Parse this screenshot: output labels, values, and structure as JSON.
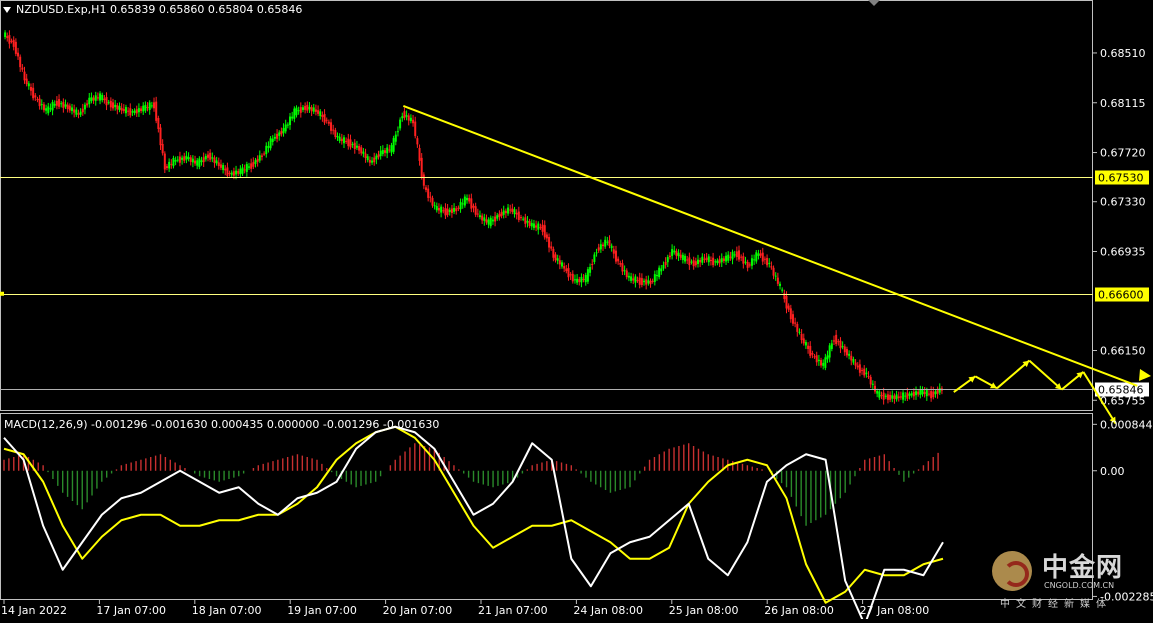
{
  "header": {
    "main_label": "NZDUSD.Exp,H1  0.65839 0.65860 0.65804 0.65846",
    "macd_label": "MACD(12,26,9) -0.001296 -0.001630 0.000435 0.000000 -0.001296 -0.001630"
  },
  "watermark": {
    "name": "中金网",
    "url": "CNGOLD.COM.CN",
    "subtitle": "中文财经新媒体"
  },
  "colors": {
    "background": "#000000",
    "bull": "#00ff00",
    "bear": "#ff2020",
    "trend": "#ffff00",
    "level_line": "#ffff80",
    "price_line": "#b0b0b0",
    "macd_line": "#ffffff",
    "signal_line": "#ffff00",
    "hist_pos": "#c83030",
    "hist_neg": "#2a8a2a",
    "axis_text": "#ffffff",
    "border": "#c0c0c0"
  },
  "chart_data": [
    {
      "type": "candlestick",
      "symbol": "NZDUSD.Exp",
      "timeframe": "H1",
      "ohlc_current": {
        "open": 0.65839,
        "high": 0.6586,
        "low": 0.65804,
        "close": 0.65846
      },
      "ylim": [
        0.6567,
        0.6893
      ],
      "y_ticks": [
        0.6851,
        0.68115,
        0.6772,
        0.6733,
        0.66935,
        0.6615,
        0.65755
      ],
      "x_ticks": [
        "14 Jan 2022",
        "17 Jan 07:00",
        "18 Jan 07:00",
        "19 Jan 07:00",
        "20 Jan 07:00",
        "21 Jan 07:00",
        "24 Jan 08:00",
        "25 Jan 08:00",
        "26 Jan 08:00",
        "27 Jan 08:00"
      ],
      "levels": [
        {
          "value": 0.6753,
          "label": "0.67530"
        },
        {
          "value": 0.666,
          "label": "0.66600"
        }
      ],
      "current_price": {
        "value": 0.65846,
        "label": "0.65846"
      },
      "path_closes": [
        0.6866,
        0.6858,
        0.683,
        0.6815,
        0.6805,
        0.6812,
        0.6808,
        0.6802,
        0.6814,
        0.6816,
        0.681,
        0.6806,
        0.6804,
        0.6807,
        0.681,
        0.676,
        0.6766,
        0.6768,
        0.6763,
        0.677,
        0.6762,
        0.6755,
        0.6757,
        0.6762,
        0.677,
        0.6783,
        0.679,
        0.6804,
        0.6808,
        0.6805,
        0.6797,
        0.6783,
        0.678,
        0.6775,
        0.6764,
        0.6772,
        0.6775,
        0.6803,
        0.6796,
        0.6745,
        0.6728,
        0.6725,
        0.6727,
        0.6736,
        0.6722,
        0.6716,
        0.6723,
        0.6727,
        0.672,
        0.6714,
        0.6712,
        0.669,
        0.668,
        0.667,
        0.6672,
        0.6695,
        0.6702,
        0.6685,
        0.6672,
        0.667,
        0.6669,
        0.668,
        0.6694,
        0.6688,
        0.6684,
        0.6688,
        0.6685,
        0.6688,
        0.6692,
        0.6682,
        0.6692,
        0.6683,
        0.6665,
        0.6642,
        0.6624,
        0.6611,
        0.6603,
        0.6625,
        0.6615,
        0.6603,
        0.6596,
        0.658,
        0.6578,
        0.6578,
        0.658,
        0.6582,
        0.658,
        0.65846
      ],
      "trendline": [
        {
          "time_index": 37,
          "value": 0.6809
        },
        {
          "time_index": 105,
          "value": 0.6587
        }
      ],
      "forecast_path": [
        {
          "time_index": 88,
          "value": 0.6582
        },
        {
          "time_index": 90,
          "value": 0.65945
        },
        {
          "time_index": 92,
          "value": 0.6585
        },
        {
          "time_index": 95,
          "value": 0.6607
        },
        {
          "time_index": 98,
          "value": 0.6584
        },
        {
          "time_index": 100,
          "value": 0.6598
        },
        {
          "time_index": 103,
          "value": 0.6557
        }
      ]
    },
    {
      "type": "line",
      "name": "MACD(12,26,9)",
      "ylim": [
        -0.00235,
        0.00105
      ],
      "y_ticks": [
        0.000844,
        0.0,
        -0.002285
      ],
      "macd_line": [
        0.0006,
        0.0002,
        -0.001,
        -0.0018,
        -0.0013,
        -0.0008,
        -0.0005,
        -0.0004,
        -0.0002,
        0.0,
        -0.0002,
        -0.0004,
        -0.0003,
        -0.0006,
        -0.0008,
        -0.0005,
        -0.0004,
        -0.0002,
        0.0004,
        0.0007,
        0.0008,
        0.0007,
        0.0004,
        -0.0002,
        -0.0008,
        -0.0006,
        -0.0002,
        0.0005,
        0.0002,
        -0.0016,
        -0.0021,
        -0.0015,
        -0.0013,
        -0.0012,
        -0.0009,
        -0.0006,
        -0.0016,
        -0.0019,
        -0.0013,
        -0.0002,
        0.0001,
        0.0003,
        0.0002,
        -0.002,
        -0.0028,
        -0.0018,
        -0.0018,
        -0.0019,
        -0.0013
      ],
      "signal_line": [
        0.0004,
        0.0003,
        -0.0002,
        -0.001,
        -0.0016,
        -0.0012,
        -0.0009,
        -0.0008,
        -0.0008,
        -0.001,
        -0.001,
        -0.0009,
        -0.0009,
        -0.0008,
        -0.0008,
        -0.0006,
        -0.0003,
        0.0002,
        0.0005,
        0.0007,
        0.0008,
        0.0006,
        0.0002,
        -0.0004,
        -0.001,
        -0.0014,
        -0.0012,
        -0.001,
        -0.001,
        -0.0009,
        -0.0011,
        -0.0013,
        -0.0016,
        -0.0016,
        -0.0014,
        -0.0006,
        -0.0002,
        0.0001,
        0.0002,
        0.0001,
        -0.0005,
        -0.0017,
        -0.0024,
        -0.0022,
        -0.0018,
        -0.0019,
        -0.0019,
        -0.0017,
        -0.0016
      ],
      "histogram": [
        0.0002,
        0.0003,
        0.0001,
        -0.0004,
        -0.0007,
        -0.0002,
        0.0001,
        0.0002,
        0.0003,
        0.0001,
        -0.0001,
        -0.0002,
        -0.0001,
        0.0001,
        0.0002,
        0.0003,
        0.0002,
        -0.0001,
        -0.0003,
        -0.0002,
        0.0002,
        0.0005,
        0.0004,
        0.0001,
        -0.0002,
        -0.0003,
        -0.0002,
        0.0001,
        0.0002,
        0.0001,
        -0.0002,
        -0.0004,
        -0.0003,
        0.0002,
        0.0004,
        0.0005,
        0.0003,
        0.0002,
        0.0001,
        0.0,
        -0.0003,
        -0.001,
        -0.0008,
        -0.0004,
        0.0002,
        0.0003,
        -0.0002,
        0.0001,
        0.0004
      ]
    }
  ]
}
